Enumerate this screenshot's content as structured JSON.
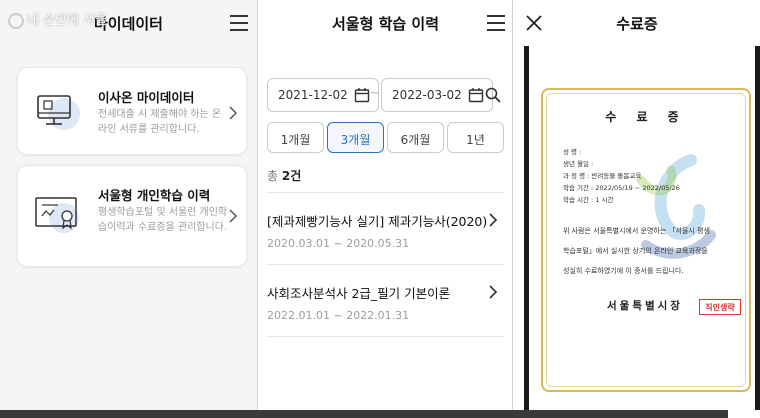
{
  "panel1": {
    "title": "마이데이터",
    "watermark": "내 손안에 서울",
    "cards": [
      {
        "title": "이사온 마이데이터",
        "desc": "전세대출 시 제출해야 하는 온라인 서류를 관리합니다.",
        "icon": "monitor-icon"
      },
      {
        "title": "서울형 개인학습 이력",
        "desc": "평생학습포털 및 서울런 개인학습이력과 수료증을 관리합니다.",
        "icon": "certificate-icon"
      }
    ]
  },
  "panel2": {
    "title": "서울형 학습 이력",
    "start_date": "2021-12-02",
    "end_date": "2022-03-02",
    "tilde": "~",
    "periods": [
      "1개월",
      "3개월",
      "6개월",
      "1년"
    ],
    "selected_period": "3개월",
    "count_label": "총",
    "count_value": "2건",
    "items": [
      {
        "title": "[제과제빵기능사 실기] 제과기능사(2020)",
        "date": "2020.03.01 ~ 2020.05.31"
      },
      {
        "title": "사회조사분석사 2급_필기 기본이론",
        "date": "2022.01.01 ~ 2022.01.31"
      }
    ]
  },
  "panel3": {
    "title": "수료증",
    "certificate": {
      "heading": "수 료 증",
      "fields": [
        "성       명 :",
        "생년 월일 :",
        "과  정  명 : 반려동물 돌봄교육",
        "학습 기간 : 2022/05/19 ~ 2022/05/26",
        "학습 시간 : 1 시간"
      ],
      "body": [
        "위 사람은 서울특별시에서 운영하는 「서울시 평생",
        "학습포털」에서 실시한 상기의 온라인 교육과정을",
        "성실히 수료하였기에 이 증서를 드립니다."
      ],
      "issuer": "서울특별시장",
      "stamp": "직인생략"
    }
  },
  "colors": {
    "accent": "#2f6fbf",
    "gold_frame": "#d7b85a",
    "stamp_red": "#d33333"
  }
}
